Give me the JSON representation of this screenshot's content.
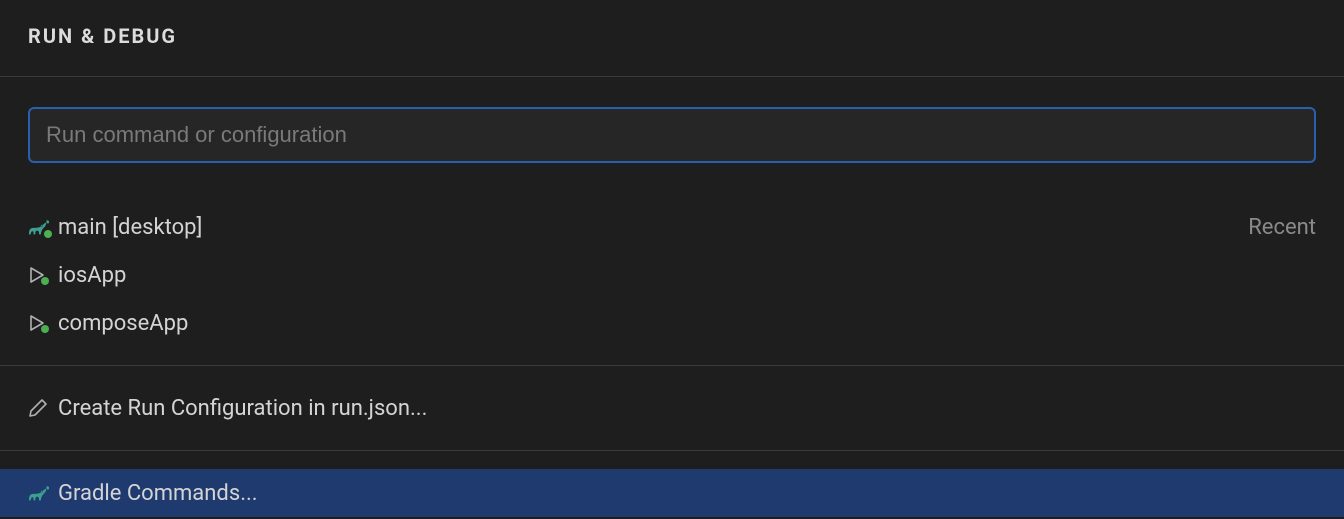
{
  "header": {
    "title": "RUN & DEBUG"
  },
  "search": {
    "placeholder": "Run command or configuration",
    "value": ""
  },
  "recentHint": "Recent",
  "items": {
    "recent": [
      {
        "label": "main [desktop]",
        "icon": "gradle"
      },
      {
        "label": "iosApp",
        "icon": "play"
      },
      {
        "label": "composeApp",
        "icon": "play"
      }
    ],
    "create": {
      "label": "Create Run Configuration in run.json...",
      "icon": "pencil"
    },
    "gradle": {
      "label": "Gradle Commands...",
      "icon": "gradle"
    }
  }
}
